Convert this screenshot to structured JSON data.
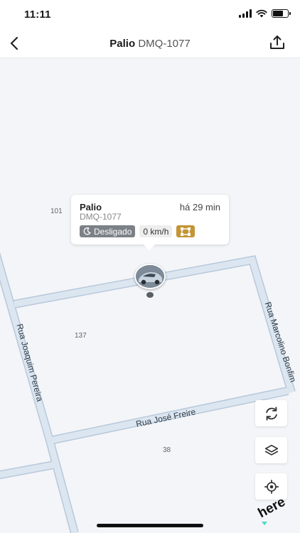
{
  "status_bar": {
    "time": "11:11"
  },
  "header": {
    "vehicle_name": "Palio",
    "plate": "DMQ-1077"
  },
  "popup": {
    "vehicle_name": "Palio",
    "plate": "DMQ-1077",
    "last_update": "há 29 min",
    "ignition_status": "Desligado",
    "speed": "0 km/h"
  },
  "map": {
    "streets": [
      "Rua Joaquim Pereira",
      "Rua Marcolino Bonfim",
      "Rua José Freire"
    ],
    "lot_numbers": [
      "101",
      "137",
      "38"
    ],
    "attribution": "here"
  },
  "icons": {
    "back": "chevron-left-icon",
    "share": "share-icon",
    "ignition": "moon-icon",
    "geofence": "geofence-icon",
    "refresh": "refresh-icon",
    "layers": "layers-icon",
    "locate": "locate-icon"
  },
  "colors": {
    "map_background": "#f3f5f8",
    "road_fill": "#dce6f1",
    "road_edge": "#b8c8da",
    "status_chip": "#7c8187",
    "geofence_chip": "#c49536",
    "here_accent": "#48dad0"
  }
}
